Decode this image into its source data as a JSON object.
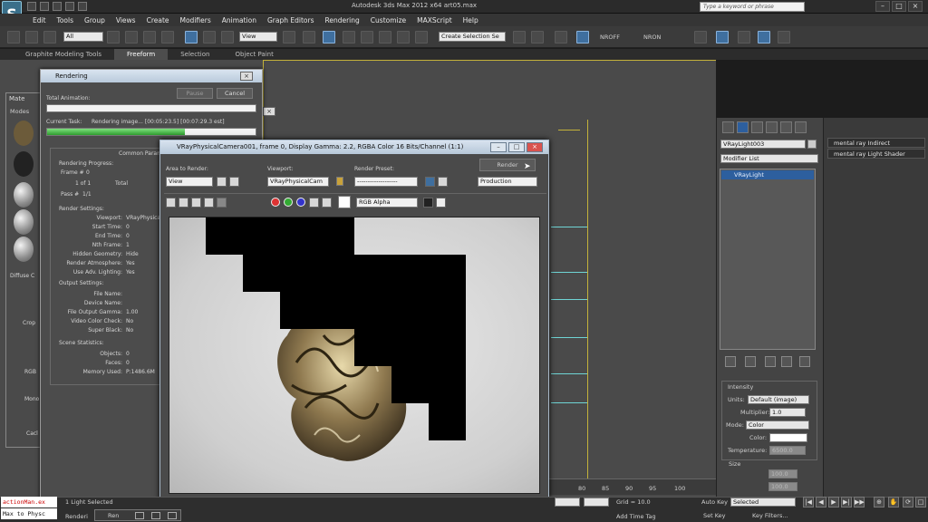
{
  "window": {
    "title": "Autodesk 3ds Max  2012 x64      art05.max",
    "search_placeholder": "Type a keyword or phrase"
  },
  "menu": [
    "Edit",
    "Tools",
    "Group",
    "Views",
    "Create",
    "Modifiers",
    "Animation",
    "Graph Editors",
    "Rendering",
    "Customize",
    "MAXScript",
    "Help"
  ],
  "toolbar": {
    "selection_filter": "All",
    "reference_coord": "View",
    "named_selection": "Create Selection Se",
    "nroff": "NROFF",
    "nron": "NRON"
  },
  "ribbon": {
    "tabs": [
      "Graphite Modeling Tools",
      "Freeform",
      "Selection",
      "Object Paint"
    ],
    "active": "Freeform"
  },
  "material_editor": {
    "title": "Mate",
    "menu": "Modes",
    "labels": [
      "Diffuse C",
      "Crop",
      "RGB",
      "Mono",
      "Cacl"
    ]
  },
  "rendering_dialog": {
    "title": "Rendering",
    "total_animation": "Total Animation:",
    "pause": "Pause",
    "cancel": "Cancel",
    "current_task_label": "Current Task:",
    "current_task": "Rendering image... [00:05:23.5] [00:07:29.3 est]",
    "task_progress": 0.66,
    "common_params": "Common Param",
    "progress_header": "Rendering Progress:",
    "frame_label": "Frame #",
    "frame_value": "0",
    "of_label": "1 of 1",
    "total_label": "Total",
    "pass_label": "Pass #",
    "pass_value": "1/1",
    "render_settings": "Render Settings:",
    "settings": [
      {
        "k": "Viewport:",
        "v": "VRayPhysicalC"
      },
      {
        "k": "Start Time:",
        "v": "0"
      },
      {
        "k": "End Time:",
        "v": "0"
      },
      {
        "k": "Nth Frame:",
        "v": "1"
      },
      {
        "k": "Hidden Geometry:",
        "v": "Hide"
      },
      {
        "k": "Render Atmosphere:",
        "v": "Yes"
      },
      {
        "k": "Use Adv. Lighting:",
        "v": "Yes"
      }
    ],
    "output_settings": "Output Settings:",
    "outputs": [
      {
        "k": "File Name:",
        "v": ""
      },
      {
        "k": "Device Name:",
        "v": ""
      },
      {
        "k": "File Output Gamma:",
        "v": "1.00"
      },
      {
        "k": "Video Color Check:",
        "v": "No"
      },
      {
        "k": "Super Black:",
        "v": "No"
      }
    ],
    "scene_stats": "Scene Statistics:",
    "stats": [
      {
        "k": "Objects:",
        "v": "0"
      },
      {
        "k": "Faces:",
        "v": "0"
      },
      {
        "k": "Memory Used:",
        "v": "P:1486.6M"
      }
    ]
  },
  "vfb": {
    "title": "VRayPhysicalCamera001, frame 0, Display Gamma: 2.2, RGBA Color 16 Bits/Channel (1:1)",
    "area_label": "Area to Render:",
    "area_value": "View",
    "viewport_label": "Viewport:",
    "viewport_value": "VRayPhysicalCam",
    "preset_label": "Render Preset:",
    "preset_value": "-------------------",
    "render_button": "Render",
    "production": "Production",
    "channel": "RGB Alpha"
  },
  "command_panel": {
    "object_name": "VRayLight003",
    "modifier_list": "Modifier List",
    "stack_item": "VRayLight",
    "intensity_header": "Intensity",
    "units_label": "Units:",
    "units_value": "Default (image)",
    "multiplier_label": "Multiplier:",
    "multiplier_value": "1.0",
    "mode_label": "Mode:",
    "mode_value": "Color",
    "color_label": "Color:",
    "temperature_label": "Temperature:",
    "temperature_value": "6500.0",
    "size_header": "Size",
    "half_length": "100.0",
    "half_width": "100.0"
  },
  "right_list": [
    "mental ray Indirect Illumination",
    "mental ray Light Shader"
  ],
  "status": {
    "listener_line1": "actionMan.ex",
    "listener_line2": "Max to Physc",
    "selected": "1 Light Selected",
    "rendering": "Renderi",
    "ren_task": "Ren",
    "grid": "Grid = 10.0",
    "auto_key": "Auto Key",
    "set_key": "Set Key",
    "selected_dropdown": "Selected",
    "key_filters": "Key Filters...",
    "add_time_tag": "Add Time Tag",
    "ticks": [
      "80",
      "85",
      "90",
      "95",
      "100"
    ]
  },
  "colors": {
    "accent": "#2d5f9e",
    "progress": "#2f9c2f",
    "viewport_frame": "#c4b23a"
  }
}
